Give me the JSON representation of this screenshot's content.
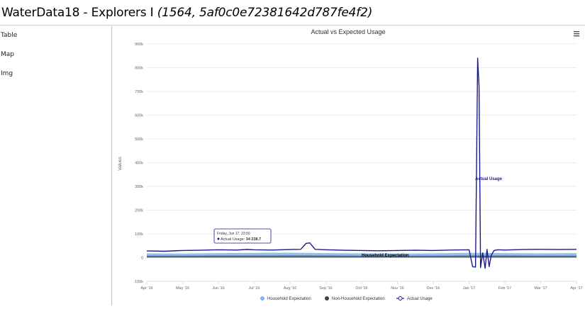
{
  "header": {
    "title": "WaterData18 - Explorers I",
    "subtitle": "(1564, 5af0c0e72381642d787fe4f2)"
  },
  "sidebar": {
    "items": [
      {
        "label": "Table"
      },
      {
        "label": "Map"
      },
      {
        "label": "Img"
      }
    ]
  },
  "chart": {
    "menu_icon": "hamburger-menu-icon",
    "tooltip": {
      "date": "Friday, Jun 17, 23:00",
      "series": "Actual Usage",
      "value": "34 238.7"
    },
    "colors": {
      "household": "#7cb5ec",
      "non_household": "#434348",
      "actual": "#1a1a8c"
    }
  },
  "chart_data": {
    "type": "area",
    "title": "Actual vs Expected Usage",
    "xlabel": "",
    "ylabel": "Values",
    "ylim": [
      -100000,
      900000
    ],
    "y_ticks": [
      -100000,
      0,
      100000,
      200000,
      300000,
      400000,
      500000,
      600000,
      700000,
      800000,
      900000
    ],
    "y_tick_labels": [
      "-100k",
      "0",
      "100k",
      "200k",
      "300k",
      "400k",
      "500k",
      "600k",
      "700k",
      "800k",
      "900k"
    ],
    "x_tick_labels": [
      "Apr '16",
      "May '16",
      "Jun '16",
      "Jul '16",
      "Aug '16",
      "Sep '16",
      "Oct '16",
      "Nov '16",
      "Dec '16",
      "Jan '17",
      "Feb '17",
      "Mar '17",
      "Apr '17"
    ],
    "grid": true,
    "legend_position": "bottom",
    "annotations": [
      "Actual Usage",
      "Household Expectation"
    ],
    "series": [
      {
        "name": "Household Expectation",
        "kind": "area",
        "x": [
          0,
          1,
          2,
          3,
          4,
          5,
          6,
          7,
          8,
          9,
          10,
          11,
          12
        ],
        "values": [
          18000,
          17000,
          19000,
          20000,
          21000,
          19000,
          18000,
          17000,
          18000,
          20000,
          19000,
          18000,
          19000
        ]
      },
      {
        "name": "Non-Household Expectation",
        "kind": "area",
        "x": [
          0,
          1,
          2,
          3,
          4,
          5,
          6,
          7,
          8,
          9,
          10,
          11,
          12
        ],
        "values": [
          8000,
          8000,
          8500,
          8500,
          9000,
          8500,
          8000,
          8000,
          8000,
          8500,
          8500,
          8000,
          8000
        ]
      },
      {
        "name": "Actual Usage",
        "kind": "line",
        "x": [
          0,
          0.5,
          1,
          1.5,
          2,
          2.5,
          2.8,
          3,
          3.5,
          4,
          4.3,
          4.45,
          4.55,
          4.7,
          5,
          5.5,
          6,
          6.5,
          7,
          7.5,
          8,
          8.5,
          9,
          9.1,
          9.18,
          9.24,
          9.28,
          9.32,
          9.38,
          9.45,
          9.5,
          9.56,
          9.62,
          9.7,
          9.8,
          10,
          10.5,
          11,
          11.5,
          12
        ],
        "values": [
          28000,
          27000,
          30000,
          31000,
          33000,
          32000,
          34238.7,
          33000,
          32000,
          34000,
          35000,
          60000,
          62000,
          35000,
          33000,
          31000,
          30000,
          29000,
          30000,
          31000,
          30000,
          32000,
          33000,
          -38000,
          -40000,
          840000,
          720000,
          -42000,
          20000,
          -45000,
          35000,
          -38000,
          10000,
          30000,
          33000,
          32000,
          34000,
          35000,
          34000,
          35000
        ]
      }
    ]
  }
}
